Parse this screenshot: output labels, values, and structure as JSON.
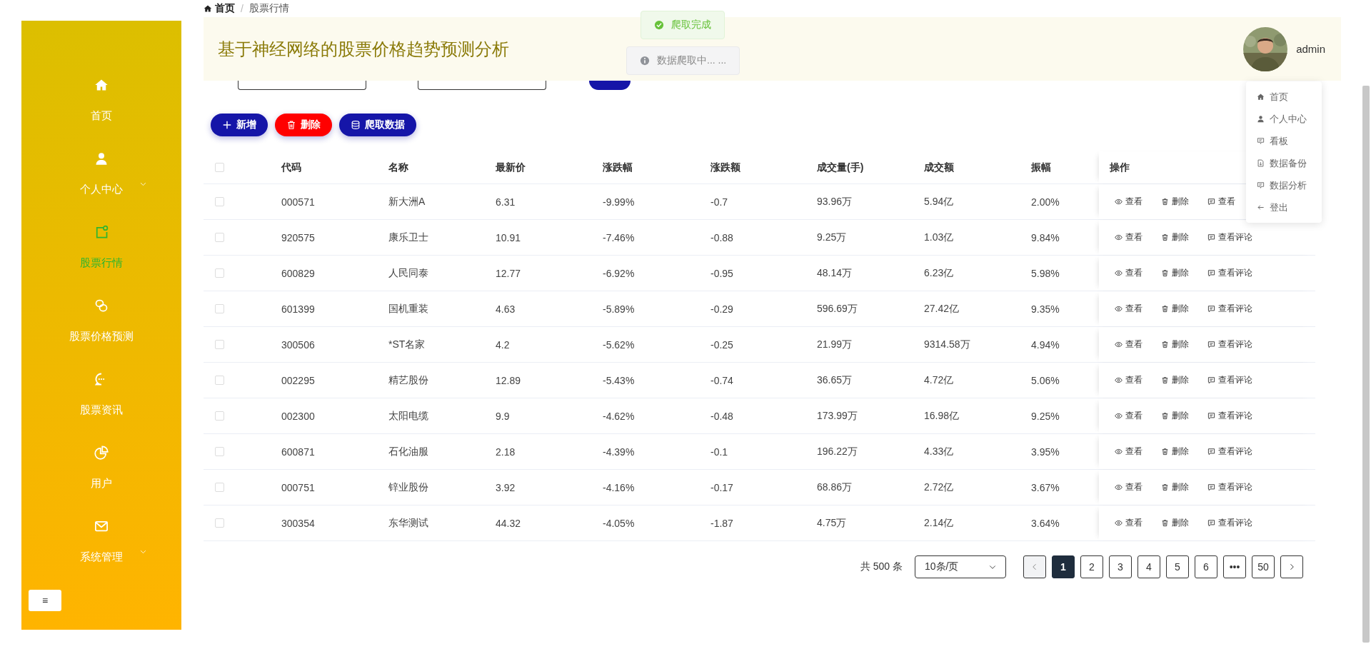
{
  "breadcrumb": {
    "separator": "/",
    "items": [
      {
        "label": "首页",
        "current": false
      },
      {
        "label": "股票行情",
        "current": true
      }
    ]
  },
  "header": {
    "title": "基于神经网络的股票价格趋势预测分析",
    "user": "admin"
  },
  "toasts": [
    {
      "kind": "success",
      "text": "爬取完成"
    },
    {
      "kind": "info",
      "text": "数据爬取中... ..."
    }
  ],
  "sidebar": {
    "items": [
      {
        "label": "首页",
        "selected": false,
        "expandable": false
      },
      {
        "label": "个人中心",
        "selected": false,
        "expandable": true
      },
      {
        "label": "股票行情",
        "selected": true,
        "expandable": false
      },
      {
        "label": "股票价格预测",
        "selected": false,
        "expandable": false
      },
      {
        "label": "股票资讯",
        "selected": false,
        "expandable": false
      },
      {
        "label": "用户",
        "selected": false,
        "expandable": false
      },
      {
        "label": "系统管理",
        "selected": false,
        "expandable": true
      }
    ],
    "collapse_button": "≡"
  },
  "toolbar": [
    {
      "kind": "add",
      "label": "新增"
    },
    {
      "kind": "delete",
      "label": "删除"
    },
    {
      "kind": "crawl",
      "label": "爬取数据"
    }
  ],
  "table": {
    "all_checked": false,
    "columns": [
      "代码",
      "名称",
      "最新价",
      "涨跌幅",
      "涨跌额",
      "成交量(手)",
      "成交额",
      "振幅",
      "操作"
    ],
    "rows": [
      {
        "checked": false,
        "cells": [
          "000571",
          "新大洲A",
          "6.31",
          "-9.99%",
          "-0.7",
          "93.96万",
          "5.94亿",
          "2.00%"
        ],
        "actions": [
          {
            "kind": "view",
            "label": "查看"
          },
          {
            "kind": "delete",
            "label": "删除"
          },
          {
            "kind": "comment",
            "label": "查看"
          }
        ]
      },
      {
        "checked": false,
        "cells": [
          "920575",
          "康乐卫士",
          "10.91",
          "-7.46%",
          "-0.88",
          "9.25万",
          "1.03亿",
          "9.84%"
        ],
        "actions": [
          {
            "kind": "view",
            "label": "查看"
          },
          {
            "kind": "delete",
            "label": "删除"
          },
          {
            "kind": "comment",
            "label": "查看评论"
          }
        ]
      },
      {
        "checked": false,
        "cells": [
          "600829",
          "人民同泰",
          "12.77",
          "-6.92%",
          "-0.95",
          "48.14万",
          "6.23亿",
          "5.98%"
        ],
        "actions": [
          {
            "kind": "view",
            "label": "查看"
          },
          {
            "kind": "delete",
            "label": "删除"
          },
          {
            "kind": "comment",
            "label": "查看评论"
          }
        ]
      },
      {
        "checked": false,
        "cells": [
          "601399",
          "国机重装",
          "4.63",
          "-5.89%",
          "-0.29",
          "596.69万",
          "27.42亿",
          "9.35%"
        ],
        "actions": [
          {
            "kind": "view",
            "label": "查看"
          },
          {
            "kind": "delete",
            "label": "删除"
          },
          {
            "kind": "comment",
            "label": "查看评论"
          }
        ]
      },
      {
        "checked": false,
        "cells": [
          "300506",
          "*ST名家",
          "4.2",
          "-5.62%",
          "-0.25",
          "21.99万",
          "9314.58万",
          "4.94%"
        ],
        "actions": [
          {
            "kind": "view",
            "label": "查看"
          },
          {
            "kind": "delete",
            "label": "删除"
          },
          {
            "kind": "comment",
            "label": "查看评论"
          }
        ]
      },
      {
        "checked": false,
        "cells": [
          "002295",
          "精艺股份",
          "12.89",
          "-5.43%",
          "-0.74",
          "36.65万",
          "4.72亿",
          "5.06%"
        ],
        "actions": [
          {
            "kind": "view",
            "label": "查看"
          },
          {
            "kind": "delete",
            "label": "删除"
          },
          {
            "kind": "comment",
            "label": "查看评论"
          }
        ]
      },
      {
        "checked": false,
        "cells": [
          "002300",
          "太阳电缆",
          "9.9",
          "-4.62%",
          "-0.48",
          "173.99万",
          "16.98亿",
          "9.25%"
        ],
        "actions": [
          {
            "kind": "view",
            "label": "查看"
          },
          {
            "kind": "delete",
            "label": "删除"
          },
          {
            "kind": "comment",
            "label": "查看评论"
          }
        ]
      },
      {
        "checked": false,
        "cells": [
          "600871",
          "石化油服",
          "2.18",
          "-4.39%",
          "-0.1",
          "196.22万",
          "4.33亿",
          "3.95%"
        ],
        "actions": [
          {
            "kind": "view",
            "label": "查看"
          },
          {
            "kind": "delete",
            "label": "删除"
          },
          {
            "kind": "comment",
            "label": "查看评论"
          }
        ]
      },
      {
        "checked": false,
        "cells": [
          "000751",
          "锌业股份",
          "3.92",
          "-4.16%",
          "-0.17",
          "68.86万",
          "2.72亿",
          "3.67%"
        ],
        "actions": [
          {
            "kind": "view",
            "label": "查看"
          },
          {
            "kind": "delete",
            "label": "删除"
          },
          {
            "kind": "comment",
            "label": "查看评论"
          }
        ]
      },
      {
        "checked": false,
        "cells": [
          "300354",
          "东华测试",
          "44.32",
          "-4.05%",
          "-1.87",
          "4.75万",
          "2.14亿",
          "3.64%"
        ],
        "actions": [
          {
            "kind": "view",
            "label": "查看"
          },
          {
            "kind": "delete",
            "label": "删除"
          },
          {
            "kind": "comment",
            "label": "查看评论"
          }
        ]
      }
    ]
  },
  "pagination": {
    "total": "共 500 条",
    "page_size": "10条/页",
    "prev_disabled": true,
    "next_disabled": false,
    "pages": [
      {
        "label": "1",
        "selected": true
      },
      {
        "label": "2",
        "selected": false
      },
      {
        "label": "3",
        "selected": false
      },
      {
        "label": "4",
        "selected": false
      },
      {
        "label": "5",
        "selected": false
      },
      {
        "label": "6",
        "selected": false
      },
      {
        "label": "•••",
        "selected": false
      },
      {
        "label": "50",
        "selected": false
      }
    ]
  },
  "user_menu": [
    {
      "kind": "home",
      "label": "首页"
    },
    {
      "kind": "user",
      "label": "个人中心"
    },
    {
      "kind": "board",
      "label": "看板"
    },
    {
      "kind": "backup",
      "label": "数据备份"
    },
    {
      "kind": "analysis",
      "label": "数据分析"
    },
    {
      "kind": "logout",
      "label": "登出"
    }
  ]
}
